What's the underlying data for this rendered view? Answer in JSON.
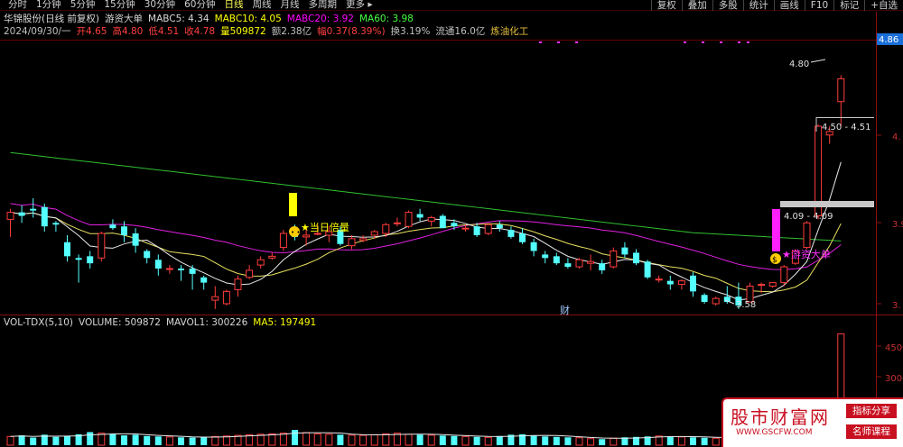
{
  "toolbar": {
    "periods": [
      "分时",
      "1分钟",
      "5分钟",
      "15分钟",
      "30分钟",
      "60分钟",
      "日线",
      "周线",
      "月线",
      "多周期",
      "更多"
    ],
    "active_period": "日线",
    "right_buttons": [
      "复权",
      "叠加",
      "多股",
      "统计",
      "画线",
      "F10",
      "标记",
      "+自选"
    ]
  },
  "info1": {
    "name": "华锦股份(日线 前复权)",
    "indicator": "游资大单",
    "mabc5": "MABC5: 4.34",
    "mabc10": "MABC10: 4.05",
    "mabc20": "MABC20: 3.92",
    "ma60": "MA60: 3.98"
  },
  "info2": {
    "date": "2024/09/30/一",
    "open": "开4.65",
    "high": "高4.80",
    "low": "低4.51",
    "close": "收4.78",
    "vol": "量509872",
    "amount": "额2.38亿",
    "change": "幅0.37(8.39%)",
    "turnover": "换3.19%",
    "float": "流通16.0亿",
    "industry": "炼油化工"
  },
  "vol_header": {
    "name": "VOL-TDX(5,10)",
    "volume": "VOLUME: 509872",
    "mavol1": "MAVOL1: 300226",
    "ma5": "MA5: 197491"
  },
  "annotations": {
    "high_label": "4.80",
    "low_label": "3.58",
    "range_top": "4.50 - 4.51",
    "range_mid": "4.09 - 4.09",
    "signal_left": "★当日倍量",
    "signal_right": "★游资大单",
    "cai": "财"
  },
  "price_axis": {
    "current": "4.86",
    "ticks": [
      "4.",
      "3.9",
      "3."
    ]
  },
  "vol_axis": {
    "ticks": [
      "4500",
      "3000"
    ]
  },
  "watermark": {
    "title": "股市财富网",
    "url": "WWW.GSCFW.COM",
    "tag1": "指标分享",
    "tag2": "名师课程"
  },
  "colors": {
    "up": "#ff3c3c",
    "down": "#54ffff",
    "ma5": "#e8e8e8",
    "ma10": "#e8e060",
    "ma20": "#e020e0",
    "ma60": "#30c030"
  },
  "chart_data": {
    "type": "candlestick",
    "title": "华锦股份(日线 前复权)",
    "ylim": [
      3.5,
      4.9
    ],
    "candles": [
      {
        "o": 3.98,
        "h": 4.04,
        "l": 3.88,
        "c": 4.02
      },
      {
        "o": 4.02,
        "h": 4.06,
        "l": 3.96,
        "c": 4.0
      },
      {
        "o": 4.04,
        "h": 4.1,
        "l": 3.99,
        "c": 4.03
      },
      {
        "o": 4.05,
        "h": 4.07,
        "l": 3.91,
        "c": 3.94
      },
      {
        "o": 3.96,
        "h": 3.97,
        "l": 3.91,
        "c": 3.95
      },
      {
        "o": 3.85,
        "h": 3.89,
        "l": 3.74,
        "c": 3.77
      },
      {
        "o": 3.76,
        "h": 3.78,
        "l": 3.62,
        "c": 3.75
      },
      {
        "o": 3.77,
        "h": 3.8,
        "l": 3.7,
        "c": 3.73
      },
      {
        "o": 3.76,
        "h": 3.91,
        "l": 3.74,
        "c": 3.9
      },
      {
        "o": 3.95,
        "h": 3.98,
        "l": 3.92,
        "c": 3.93
      },
      {
        "o": 3.94,
        "h": 3.97,
        "l": 3.85,
        "c": 3.89
      },
      {
        "o": 3.9,
        "h": 3.93,
        "l": 3.79,
        "c": 3.83
      },
      {
        "o": 3.8,
        "h": 3.81,
        "l": 3.73,
        "c": 3.76
      },
      {
        "o": 3.75,
        "h": 3.78,
        "l": 3.66,
        "c": 3.7
      },
      {
        "o": 3.7,
        "h": 3.72,
        "l": 3.67,
        "c": 3.7
      },
      {
        "o": 3.7,
        "h": 3.72,
        "l": 3.63,
        "c": 3.69
      },
      {
        "o": 3.7,
        "h": 3.72,
        "l": 3.58,
        "c": 3.67
      },
      {
        "o": 3.65,
        "h": 3.66,
        "l": 3.58,
        "c": 3.62
      },
      {
        "o": 3.52,
        "h": 3.6,
        "l": 3.47,
        "c": 3.54
      },
      {
        "o": 3.5,
        "h": 3.58,
        "l": 3.49,
        "c": 3.57
      },
      {
        "o": 3.58,
        "h": 3.66,
        "l": 3.54,
        "c": 3.64
      },
      {
        "o": 3.65,
        "h": 3.72,
        "l": 3.64,
        "c": 3.69
      },
      {
        "o": 3.72,
        "h": 3.77,
        "l": 3.7,
        "c": 3.75
      },
      {
        "o": 3.76,
        "h": 3.79,
        "l": 3.75,
        "c": 3.77
      },
      {
        "o": 3.82,
        "h": 3.92,
        "l": 3.8,
        "c": 3.9
      },
      {
        "o": 3.9,
        "h": 3.95,
        "l": 3.86,
        "c": 3.88
      },
      {
        "o": 3.88,
        "h": 3.94,
        "l": 3.83,
        "c": 3.89
      },
      {
        "o": 3.9,
        "h": 3.95,
        "l": 3.89,
        "c": 3.9
      },
      {
        "o": 3.89,
        "h": 3.94,
        "l": 3.85,
        "c": 3.91
      },
      {
        "o": 3.92,
        "h": 3.94,
        "l": 3.83,
        "c": 3.84
      },
      {
        "o": 3.83,
        "h": 3.89,
        "l": 3.81,
        "c": 3.87
      },
      {
        "o": 3.86,
        "h": 3.89,
        "l": 3.85,
        "c": 3.87
      },
      {
        "o": 3.89,
        "h": 3.92,
        "l": 3.87,
        "c": 3.91
      },
      {
        "o": 3.9,
        "h": 3.96,
        "l": 3.88,
        "c": 3.95
      },
      {
        "o": 3.96,
        "h": 3.99,
        "l": 3.94,
        "c": 3.96
      },
      {
        "o": 3.94,
        "h": 4.03,
        "l": 3.93,
        "c": 4.02
      },
      {
        "o": 4.01,
        "h": 4.04,
        "l": 3.97,
        "c": 3.99
      },
      {
        "o": 3.97,
        "h": 4.0,
        "l": 3.94,
        "c": 3.99
      },
      {
        "o": 4.0,
        "h": 4.01,
        "l": 3.93,
        "c": 3.93
      },
      {
        "o": 3.96,
        "h": 3.98,
        "l": 3.92,
        "c": 3.94
      },
      {
        "o": 3.93,
        "h": 3.95,
        "l": 3.91,
        "c": 3.93
      },
      {
        "o": 3.94,
        "h": 3.96,
        "l": 3.88,
        "c": 3.89
      },
      {
        "o": 3.9,
        "h": 3.96,
        "l": 3.89,
        "c": 3.95
      },
      {
        "o": 3.95,
        "h": 3.97,
        "l": 3.91,
        "c": 3.93
      },
      {
        "o": 3.92,
        "h": 3.94,
        "l": 3.87,
        "c": 3.88
      },
      {
        "o": 3.9,
        "h": 3.93,
        "l": 3.84,
        "c": 3.85
      },
      {
        "o": 3.85,
        "h": 3.87,
        "l": 3.77,
        "c": 3.8
      },
      {
        "o": 3.78,
        "h": 3.8,
        "l": 3.73,
        "c": 3.76
      },
      {
        "o": 3.77,
        "h": 3.79,
        "l": 3.72,
        "c": 3.73
      },
      {
        "o": 3.73,
        "h": 3.76,
        "l": 3.7,
        "c": 3.71
      },
      {
        "o": 3.71,
        "h": 3.76,
        "l": 3.7,
        "c": 3.75
      },
      {
        "o": 3.73,
        "h": 3.78,
        "l": 3.69,
        "c": 3.74
      },
      {
        "o": 3.73,
        "h": 3.75,
        "l": 3.67,
        "c": 3.69
      },
      {
        "o": 3.71,
        "h": 3.82,
        "l": 3.7,
        "c": 3.8
      },
      {
        "o": 3.82,
        "h": 3.85,
        "l": 3.76,
        "c": 3.78
      },
      {
        "o": 3.79,
        "h": 3.81,
        "l": 3.72,
        "c": 3.73
      },
      {
        "o": 3.74,
        "h": 3.75,
        "l": 3.64,
        "c": 3.65
      },
      {
        "o": 3.64,
        "h": 3.66,
        "l": 3.62,
        "c": 3.64
      },
      {
        "o": 3.63,
        "h": 3.66,
        "l": 3.58,
        "c": 3.61
      },
      {
        "o": 3.61,
        "h": 3.64,
        "l": 3.58,
        "c": 3.63
      },
      {
        "o": 3.66,
        "h": 3.68,
        "l": 3.54,
        "c": 3.57
      },
      {
        "o": 3.55,
        "h": 3.56,
        "l": 3.5,
        "c": 3.51
      },
      {
        "o": 3.5,
        "h": 3.54,
        "l": 3.49,
        "c": 3.53
      },
      {
        "o": 3.54,
        "h": 3.6,
        "l": 3.5,
        "c": 3.51
      },
      {
        "o": 3.54,
        "h": 3.62,
        "l": 3.47,
        "c": 3.49
      },
      {
        "o": 3.51,
        "h": 3.62,
        "l": 3.51,
        "c": 3.6
      },
      {
        "o": 3.61,
        "h": 3.62,
        "l": 3.56,
        "c": 3.61
      },
      {
        "o": 3.6,
        "h": 3.62,
        "l": 3.59,
        "c": 3.62
      },
      {
        "o": 3.62,
        "h": 3.72,
        "l": 3.6,
        "c": 3.71
      },
      {
        "o": 3.73,
        "h": 3.81,
        "l": 3.72,
        "c": 3.8
      },
      {
        "o": 3.82,
        "h": 3.97,
        "l": 3.81,
        "c": 3.96
      },
      {
        "o": 4.0,
        "h": 4.52,
        "l": 3.98,
        "c": 4.51
      },
      {
        "o": 4.46,
        "h": 4.51,
        "l": 4.41,
        "c": 4.48
      },
      {
        "o": 4.65,
        "h": 4.8,
        "l": 4.51,
        "c": 4.78
      }
    ],
    "volume": [
      40,
      45,
      35,
      48,
      38,
      42,
      50,
      60,
      55,
      50,
      45,
      48,
      42,
      40,
      38,
      36,
      35,
      38,
      40,
      42,
      45,
      48,
      50,
      52,
      55,
      70,
      58,
      52,
      50,
      48,
      46,
      45,
      48,
      52,
      55,
      50,
      48,
      46,
      44,
      42,
      40,
      38,
      36,
      42,
      48,
      50,
      45,
      40,
      38,
      36,
      34,
      30,
      28,
      32,
      36,
      38,
      40,
      42,
      40,
      38,
      36,
      34,
      32,
      35,
      40,
      45,
      48,
      50,
      55,
      60,
      70,
      110,
      120,
      510
    ],
    "series": [
      {
        "name": "MABC5",
        "values": "computed"
      },
      {
        "name": "MABC10",
        "values": "computed"
      },
      {
        "name": "MABC20",
        "values": "computed"
      },
      {
        "name": "MA60",
        "values": "computed"
      }
    ]
  }
}
